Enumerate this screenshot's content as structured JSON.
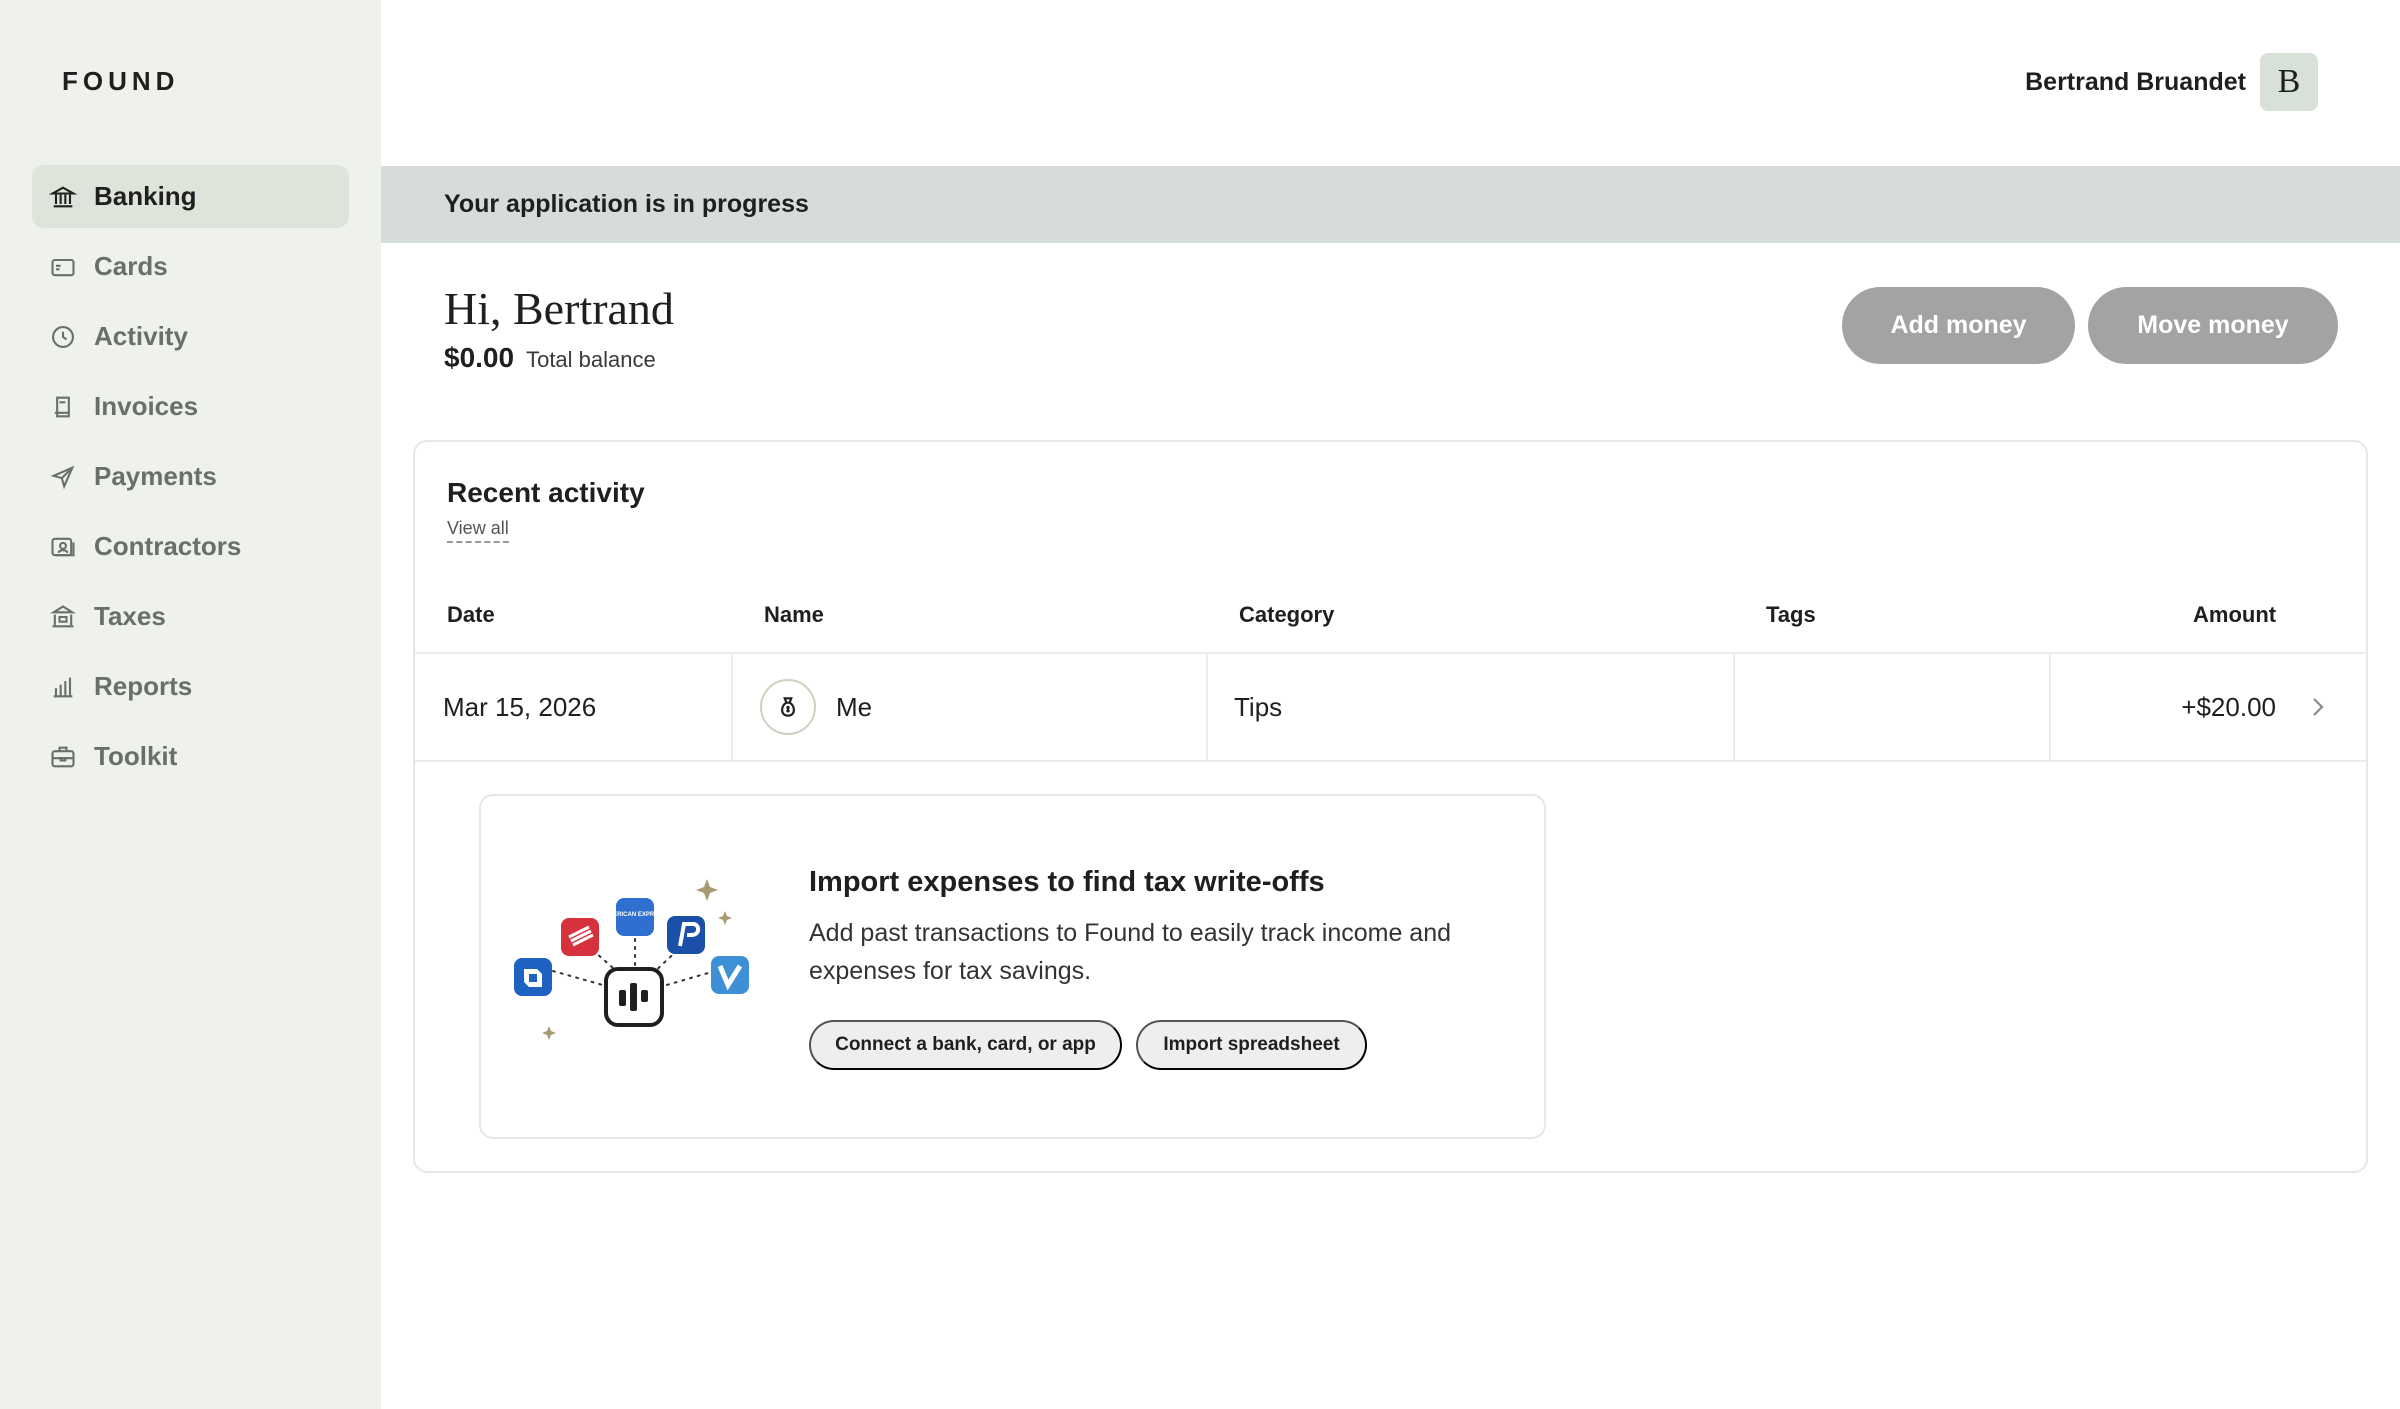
{
  "brand": {
    "logo": "FOUND"
  },
  "sidebar": {
    "items": [
      {
        "label": "Banking",
        "icon": "bank-icon",
        "active": true
      },
      {
        "label": "Cards",
        "icon": "card-icon"
      },
      {
        "label": "Activity",
        "icon": "clock-icon"
      },
      {
        "label": "Invoices",
        "icon": "invoice-icon"
      },
      {
        "label": "Payments",
        "icon": "send-icon"
      },
      {
        "label": "Contractors",
        "icon": "contractor-icon"
      },
      {
        "label": "Taxes",
        "icon": "taxes-icon"
      },
      {
        "label": "Reports",
        "icon": "bar-chart-icon"
      },
      {
        "label": "Toolkit",
        "icon": "briefcase-icon"
      }
    ]
  },
  "header": {
    "user_name": "Bertrand Bruandet",
    "avatar_initial": "B"
  },
  "banner": {
    "text": "Your application is in progress"
  },
  "summary": {
    "greeting": "Hi, Bertrand",
    "balance": "$0.00",
    "balance_label": "Total balance",
    "add_money": "Add money",
    "move_money": "Move money"
  },
  "activity": {
    "title": "Recent activity",
    "view_all": "View all",
    "columns": [
      "Date",
      "Name",
      "Category",
      "Tags",
      "Amount"
    ],
    "rows": [
      {
        "date": "Mar 15, 2026",
        "name": "Me",
        "category": "Tips",
        "tags": "",
        "amount": "+$20.00"
      }
    ]
  },
  "import_card": {
    "title": "Import expenses to find tax write-offs",
    "description": "Add past transactions to Found to easily track income and expenses for tax savings.",
    "connect_label": "Connect a bank, card, or app",
    "import_label": "Import spreadsheet",
    "logo_text": "AMERICAN EXPRESS"
  },
  "colors": {
    "sidebar_bg": "#eff1ec",
    "active_item_bg": "#dfe4da",
    "banner_bg": "#d6ddd8",
    "button_disabled": "#a3a3a3"
  }
}
